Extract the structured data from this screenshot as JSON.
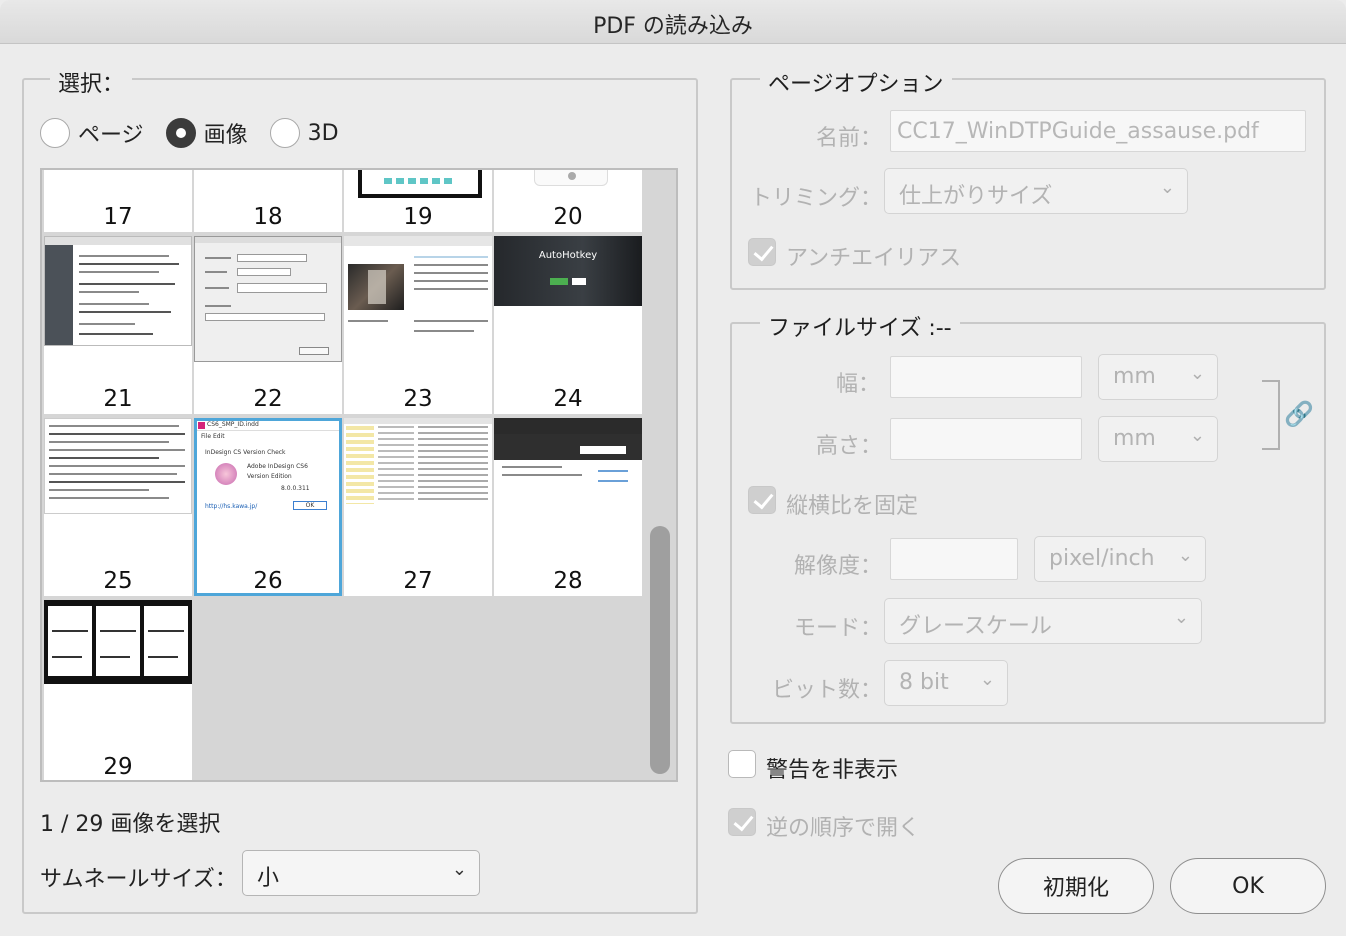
{
  "window": {
    "title": "PDF の読み込み"
  },
  "select": {
    "group_title": "選択：",
    "modes": [
      {
        "label": "ページ",
        "selected": false
      },
      {
        "label": "画像",
        "selected": true
      },
      {
        "label": "3D",
        "selected": false
      }
    ],
    "thumbnails": [
      "17",
      "18",
      "19",
      "20",
      "21",
      "22",
      "23",
      "24",
      "25",
      "26",
      "27",
      "28",
      "29"
    ],
    "selected_thumbnail": "26",
    "thumb_text": {
      "t24_title": "AutoHotkey",
      "t26_title": "CS6_SMP_ID.indd",
      "t26_menu": "File  Edit",
      "t26_heading": "InDesign CS Version Check",
      "t26_app": "Adobe InDesign CS6",
      "t26_edition": "Version Edition",
      "t26_version": "8.0.0.311",
      "t26_link": "http://hs.kawa.jp/",
      "t26_ok": "OK"
    },
    "count_text": "1 / 29 画像を選択",
    "thumb_size_label": "サムネールサイズ：",
    "thumb_size_value": "小"
  },
  "page_options": {
    "group_title": "ページオプション",
    "name_label": "名前：",
    "name_value": "CC17_WinDTPGuide_assause.pdf",
    "crop_label": "トリミング：",
    "crop_value": "仕上がりサイズ",
    "antialias_label": "アンチエイリアス",
    "antialias_checked": true
  },
  "file_size": {
    "group_title": "ファイルサイズ :--",
    "width_label": "幅：",
    "width_unit": "mm",
    "height_label": "高さ：",
    "height_unit": "mm",
    "constrain_label": "縦横比を固定",
    "constrain_checked": true,
    "resolution_label": "解像度：",
    "resolution_unit": "pixel/inch",
    "mode_label": "モード：",
    "mode_value": "グレースケール",
    "bits_label": "ビット数：",
    "bits_value": "8 bit"
  },
  "options": {
    "hide_warnings_label": "警告を非表示",
    "hide_warnings_checked": false,
    "reverse_order_label": "逆の順序で開く",
    "reverse_order_checked": true
  },
  "buttons": {
    "reset": "初期化",
    "ok": "OK"
  },
  "colors": {
    "selection_outline": "#4ea6d9",
    "dialog_bg": "#ececec"
  }
}
